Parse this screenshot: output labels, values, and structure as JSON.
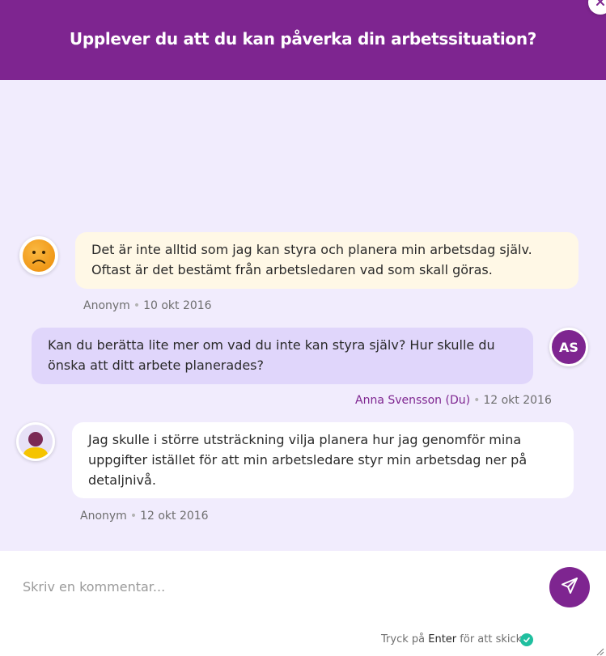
{
  "header": {
    "title": "Upplever du att du kan påverka din arbetssituation?",
    "close_icon": "close-icon"
  },
  "colors": {
    "brand": "#7e2590",
    "chat_bg": "#f1ecfd",
    "bubble_anon_1": "#fff8e6",
    "bubble_self": "#e0d6fb",
    "bubble_anon_2": "#ffffff",
    "check": "#1fbf9f"
  },
  "messages": [
    {
      "avatar": "sad-face-emoji",
      "text": "Det är inte alltid som jag kan styra och planera min arbetsdag själv. Oftast är det bestämt från arbetsledaren vad som skall göras.",
      "author": "Anonym",
      "date": "10 okt 2016"
    },
    {
      "avatar_initials": "AS",
      "text": "Kan du berätta lite mer om vad du inte kan styra själv? Hur skulle du önska att ditt arbete planerades?",
      "author": "Anna Svensson (Du)",
      "date": "12 okt 2016"
    },
    {
      "avatar": "user-silhouette",
      "text": "Jag skulle i större utsträckning vilja planera hur jag genomför mina uppgifter istället för att min arbetsledare styr min arbetsdag ner på detaljnivå.",
      "author": "Anonym",
      "date": "12 okt 2016"
    }
  ],
  "composer": {
    "placeholder": "Skriv en kommentar...",
    "value": "",
    "hint_before": "Tryck på",
    "hint_key": "Enter",
    "hint_after": "för att skicka",
    "send_icon": "paper-plane-icon",
    "check_icon": "check-icon"
  }
}
